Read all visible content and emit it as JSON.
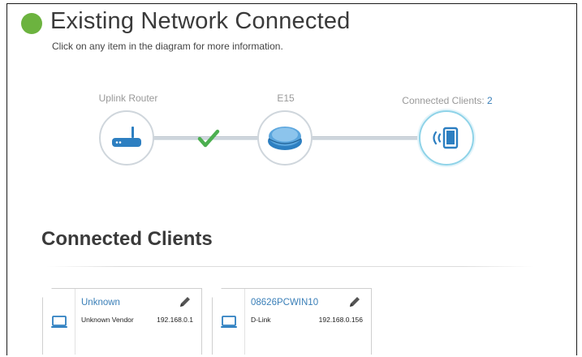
{
  "header": {
    "title": "Existing Network Connected",
    "subtitle": "Click on any item in the diagram for more information.",
    "status_color": "#6cb33f"
  },
  "diagram": {
    "uplink_label": "Uplink Router",
    "extender_label": "E15",
    "clients_label": "Connected Clients: ",
    "clients_count": "2",
    "link_status": "connected"
  },
  "clients_section": {
    "title": "Connected Clients",
    "clients": [
      {
        "name": "Unknown",
        "vendor": "Unknown Vendor",
        "ip": "192.168.0.1",
        "icon": "laptop-icon"
      },
      {
        "name": "08626PCWIN10",
        "vendor": "D-Link",
        "ip": "192.168.0.156",
        "icon": "laptop-icon"
      }
    ]
  },
  "colors": {
    "accent": "#3a7fb8",
    "check": "#4caf50",
    "active_ring": "#8fd3e8"
  }
}
